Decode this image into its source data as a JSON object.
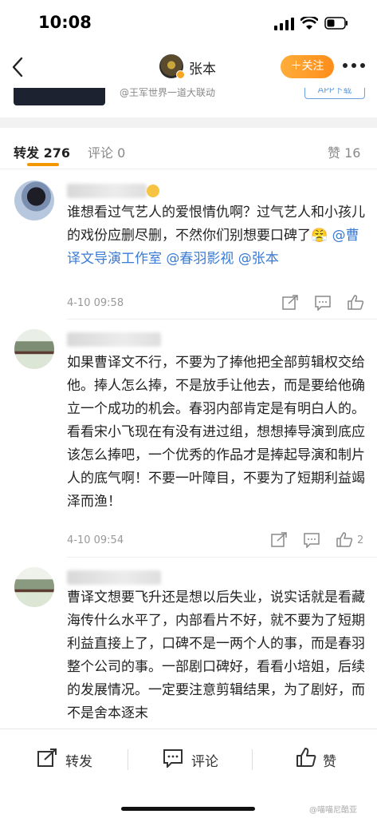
{
  "status_bar": {
    "time": "10:08"
  },
  "nav": {
    "title": "张本",
    "follow_label": "＋关注"
  },
  "peek": {
    "source": "@王军世界一道大联动",
    "app_label": "APP下载"
  },
  "tabs": {
    "repost": "转发 276",
    "comment": "评论 0",
    "like": "赞 16"
  },
  "comments": [
    {
      "text": "谁想看过气艺人的爱恨情仇啊？过气艺人和小孩儿的戏份应删尽删，不然你们别想要口碑了",
      "mentions": "@曹译文导演工作室 @春羽影视 @张本",
      "time": "4-10 09:58",
      "likes": ""
    },
    {
      "text": "如果曹译文不行，不要为了捧他把全部剪辑权交给他。捧人怎么捧，不是放手让他去，而是要给他确立一个成功的机会。春羽内部肯定是有明白人的。看看宋小飞现在有没有进过组，想想捧导演到底应该怎么捧吧，一个优秀的作品才是捧起导演和制片人的底气啊！不要一叶障目，不要为了短期利益竭泽而渔！",
      "time": "4-10 09:54",
      "likes": "2"
    },
    {
      "text": "曹译文想要飞升还是想以后失业，说实话就是看藏海传什么水平了，内部看片不好，就不要为了短期利益直接上了，口碑不是一两个人的事，而是春羽整个公司的事。一部剧口碑好，看看小培姐，后续的发展情况。一定要注意剪辑结果，为了剧好，而不是舍本逐末"
    }
  ],
  "bottom_bar": {
    "repost": "转发",
    "comment": "评论",
    "like": "赞"
  },
  "watermark": "@喵喵尼酷亚",
  "colors": {
    "accent": "#f39800",
    "link": "#3a7bd5",
    "follow": "#ff9a2a"
  },
  "icons": [
    "back-icon",
    "more-icon",
    "share-icon",
    "comment-icon",
    "like-icon"
  ]
}
